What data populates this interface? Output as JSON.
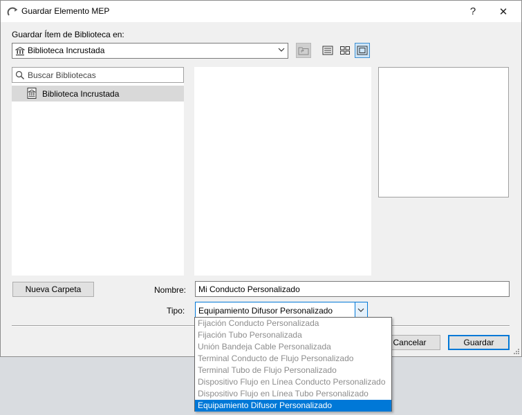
{
  "window": {
    "title": "Guardar Elemento MEP",
    "help_glyph": "?",
    "close_glyph": "✕"
  },
  "location": {
    "label": "Guardar Ítem de Biblioteca en:",
    "selected": "Biblioteca Incrustada"
  },
  "search": {
    "placeholder": "Buscar Bibliotecas"
  },
  "library_tree": [
    {
      "label": "Biblioteca Incrustada",
      "selected": true
    }
  ],
  "buttons": {
    "new_folder": "Nueva Carpeta",
    "cancel": "Cancelar",
    "save": "Guardar"
  },
  "name_field": {
    "label": "Nombre:",
    "value": "Mi Conducto Personalizado"
  },
  "type_field": {
    "label": "Tipo:",
    "value": "Equipamiento Difusor Personalizado",
    "options": [
      "Fijación Conducto Personalizada",
      "Fijación Tubo Personalizada",
      "Unión Bandeja Cable Personalizada",
      "Terminal Conducto de Flujo Personalizado",
      "Terminal Tubo de Flujo Personalizado",
      "Dispositivo Flujo en Línea Conducto Personalizado",
      "Dispositivo Flujo en Línea Tubo Personalizado",
      "Equipamiento Difusor Personalizado"
    ],
    "selected_index": 7
  },
  "icons": {
    "app": "arc-logo-icon",
    "library": "library-building-icon",
    "search": "search-icon",
    "up_folder": "folder-up-icon",
    "list_view": "list-view-icon",
    "icon_view": "icon-view-icon",
    "preview_view": "preview-view-icon"
  },
  "colors": {
    "accent": "#0078d7",
    "selected_row": "#d9d9d9",
    "dialog_bg": "#f0f0f0"
  }
}
